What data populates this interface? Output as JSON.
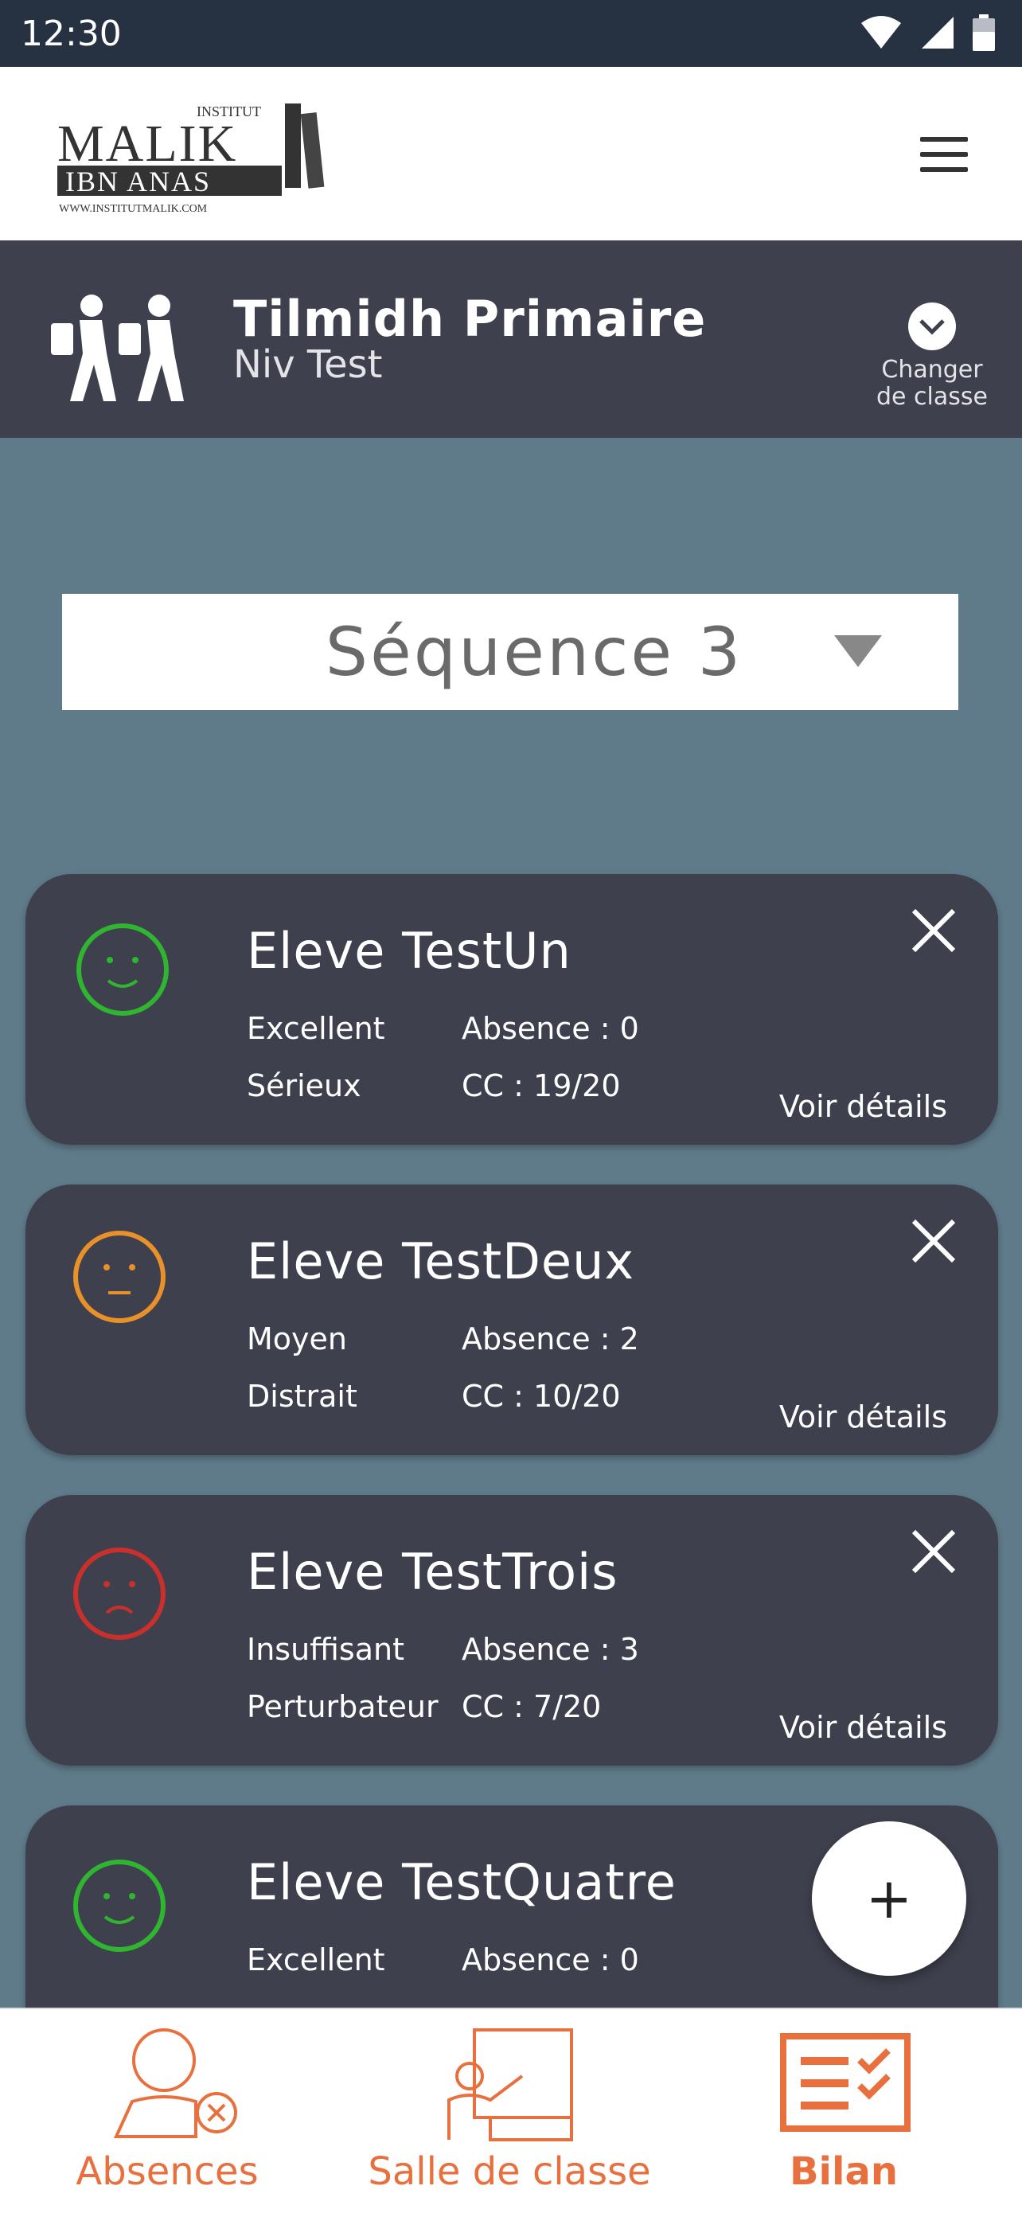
{
  "status_bar": {
    "time": "12:30"
  },
  "header": {
    "logo": {
      "line1": "INSTITUT",
      "line2": "MALIK",
      "line3": "IBN ANAS",
      "line4": "WWW.INSTITUTMALIK.COM"
    }
  },
  "class_bar": {
    "title": "Tilmidh Primaire",
    "subtitle": "Niv Test",
    "change_label_line1": "Changer",
    "change_label_line2": "de classe"
  },
  "sequence_select": {
    "selected": "Séquence 3"
  },
  "students": [
    {
      "name": "Eleve TestUn",
      "level": "Excellent",
      "behavior": "Sérieux",
      "absence": "Absence : 0",
      "cc": "CC : 19/20",
      "mood": "happy",
      "mood_color": "#2fb52f",
      "details": "Voir détails"
    },
    {
      "name": "Eleve TestDeux",
      "level": "Moyen",
      "behavior": "Distrait",
      "absence": "Absence : 2",
      "cc": "CC : 10/20",
      "mood": "neutral",
      "mood_color": "#e8902a",
      "details": "Voir détails"
    },
    {
      "name": "Eleve TestTrois",
      "level": "Insuffisant",
      "behavior": "Perturbateur",
      "absence": "Absence : 3",
      "cc": "CC : 7/20",
      "mood": "sad",
      "mood_color": "#c9302c",
      "details": "Voir détails"
    },
    {
      "name": "Eleve TestQuatre",
      "level": "Excellent",
      "behavior": "",
      "absence": "Absence : 0",
      "cc": "",
      "mood": "happy",
      "mood_color": "#2fb52f",
      "details": ""
    }
  ],
  "fab": {
    "label": "+"
  },
  "bottom_nav": [
    {
      "label": "Absences",
      "icon": "absent-person-icon"
    },
    {
      "label": "Salle de classe",
      "icon": "classroom-icon"
    },
    {
      "label": "Bilan",
      "icon": "checklist-icon"
    }
  ],
  "colors": {
    "accent": "#e8703f",
    "dark": "#3e404d",
    "statusbar": "#263142",
    "background": "#5f7a89"
  }
}
